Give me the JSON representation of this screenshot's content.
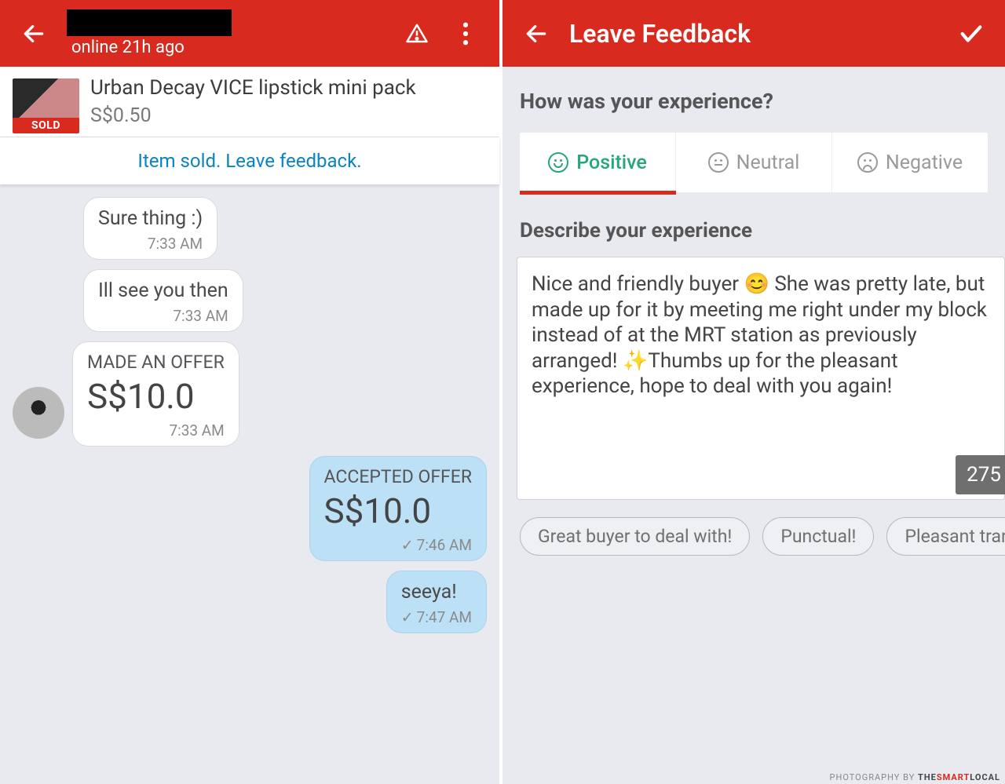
{
  "left": {
    "header": {
      "presence": "online 21h ago"
    },
    "product": {
      "sold_badge": "SOLD",
      "title": "Urban Decay VICE lipstick mini pack",
      "price": "S$0.50"
    },
    "feedback_link": "Item sold. Leave feedback.",
    "messages": [
      {
        "side": "in",
        "text": "Sure thing :)",
        "time": "7:33 AM"
      },
      {
        "side": "in",
        "text": "Ill see you then",
        "time": "7:33 AM"
      },
      {
        "side": "in",
        "offer_label": "MADE AN OFFER",
        "offer_amount": "S$10.0",
        "time": "7:33 AM"
      },
      {
        "side": "out",
        "offer_label": "ACCEPTED OFFER",
        "offer_amount": "S$10.0",
        "time": "7:46 AM",
        "checked": true
      },
      {
        "side": "out",
        "text": "seeya!",
        "time": "7:47 AM",
        "checked": true
      }
    ]
  },
  "right": {
    "header": {
      "title": "Leave Feedback"
    },
    "prompt": "How was your experience?",
    "tabs": {
      "positive": "Positive",
      "neutral": "Neutral",
      "negative": "Negative"
    },
    "describe_label": "Describe your experience",
    "feedback_text": "Nice and friendly buyer 😊 She was pretty late, but made up for it by meeting me right under my block instead of at the MRT station as previously arranged! ✨Thumbs up for the pleasant experience, hope to deal with you again!",
    "char_count": "275",
    "chips": [
      "Great buyer to deal with!",
      "Punctual!",
      "Pleasant transactio"
    ]
  },
  "watermark": {
    "prefix": "PHOTOGRAPHY BY",
    "brand1": "THE",
    "brand2": "SMART",
    "brand3": "LOCAL"
  }
}
